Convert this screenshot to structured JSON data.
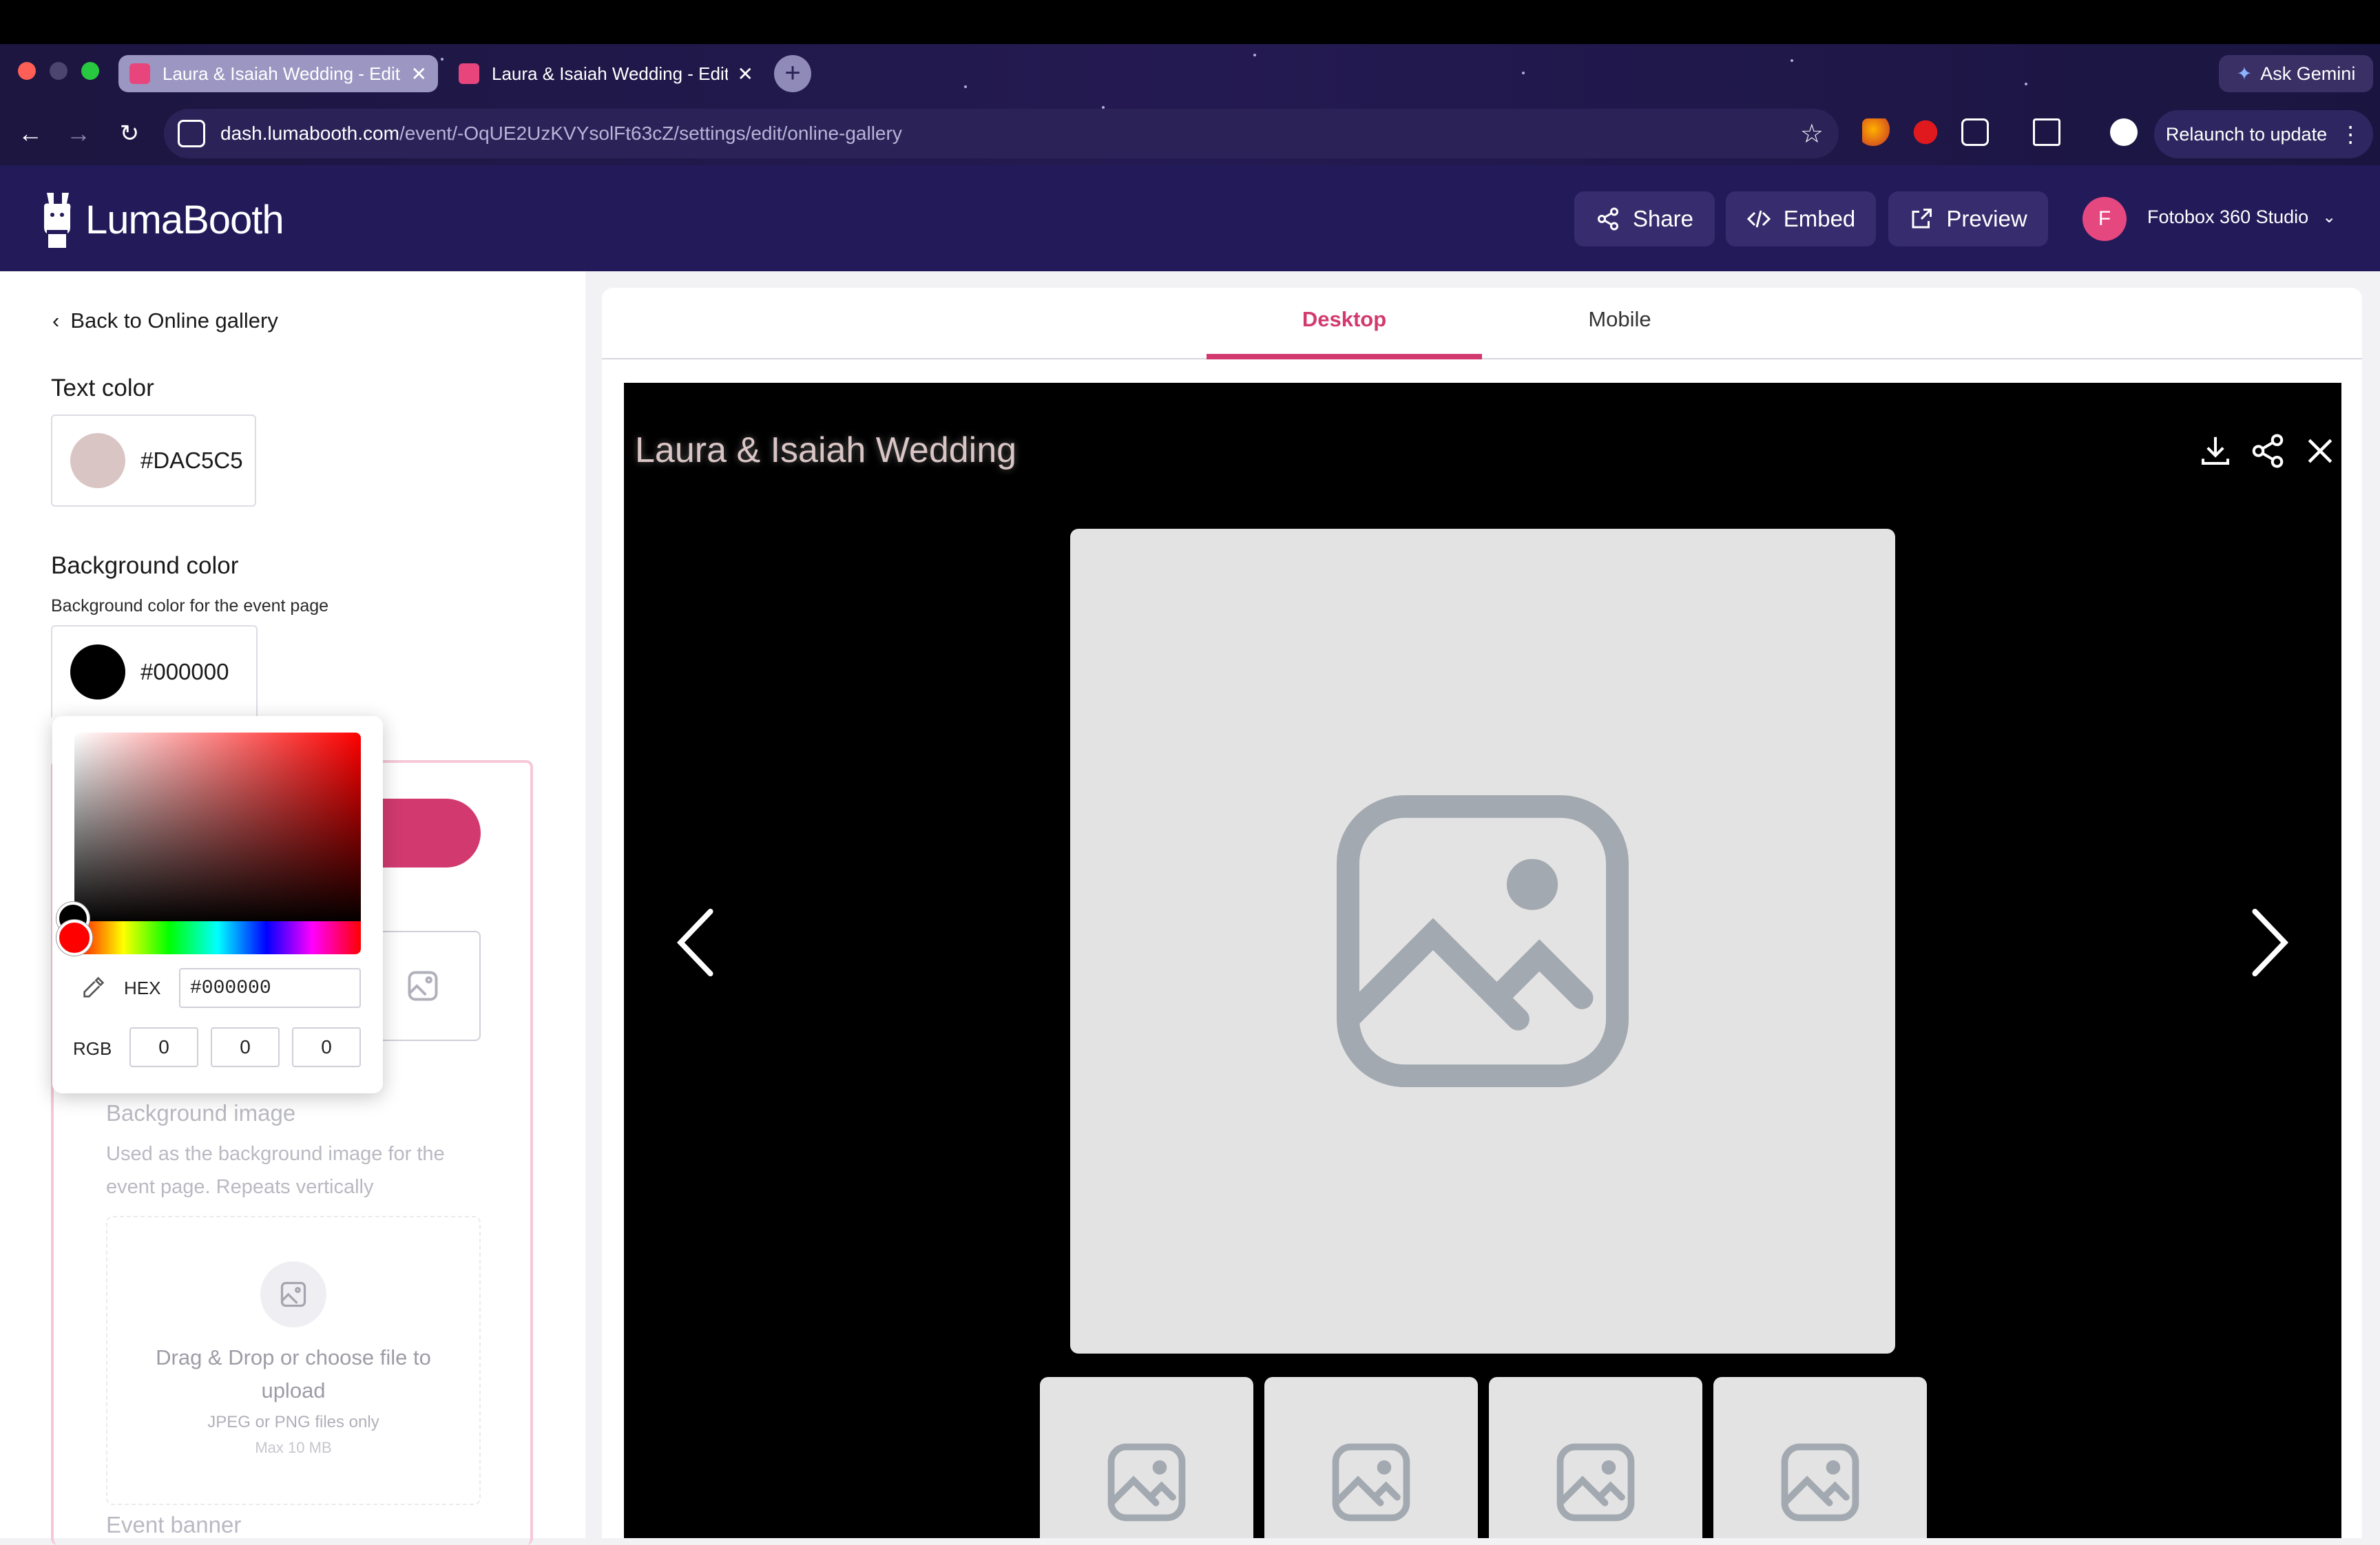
{
  "browser": {
    "tabs": [
      {
        "title": "Laura & Isaiah Wedding - Edit",
        "active": true
      },
      {
        "title": "Laura & Isaiah Wedding - Edit",
        "active": false
      }
    ],
    "ask_gemini": "Ask Gemini",
    "url_host": "dash.lumabooth.com",
    "url_path": "/event/-OqUE2UzKVYsolFt63cZ/settings/edit/online-gallery",
    "relaunch": "Relaunch to update"
  },
  "header": {
    "logo": "LumaBooth",
    "share": "Share",
    "embed": "Embed",
    "preview": "Preview",
    "avatar_initial": "F",
    "account": "Fotobox 360 Studio"
  },
  "sidebar": {
    "back": "Back to Online gallery",
    "text_color_label": "Text color",
    "text_color": "#DAC5C5",
    "bg_color_label": "Background color",
    "bg_color_desc": "Background color for the event page",
    "bg_color": "#000000",
    "bg_image_label": "Background image",
    "bg_image_desc_1": "Used as the background image for the",
    "bg_image_desc_2": "event page. Repeats vertically",
    "drop_title_1": "Drag & Drop or choose file to",
    "drop_title_2": "upload",
    "drop_formats": "JPEG or PNG files only",
    "drop_max": "Max 10 MB",
    "event_banner_label": "Event banner"
  },
  "picker": {
    "hex_label": "HEX",
    "hex_value": "#000000",
    "rgb_label": "RGB",
    "r": "0",
    "g": "0",
    "b": "0"
  },
  "preview": {
    "tabs": [
      "Desktop",
      "Mobile"
    ],
    "active_tab": "Desktop",
    "event_title": "Laura & Isaiah Wedding"
  },
  "colors": {
    "accent": "#d23a6f",
    "header_bg": "#231a5a",
    "text_color": "#dac5c5",
    "background": "#000000"
  }
}
